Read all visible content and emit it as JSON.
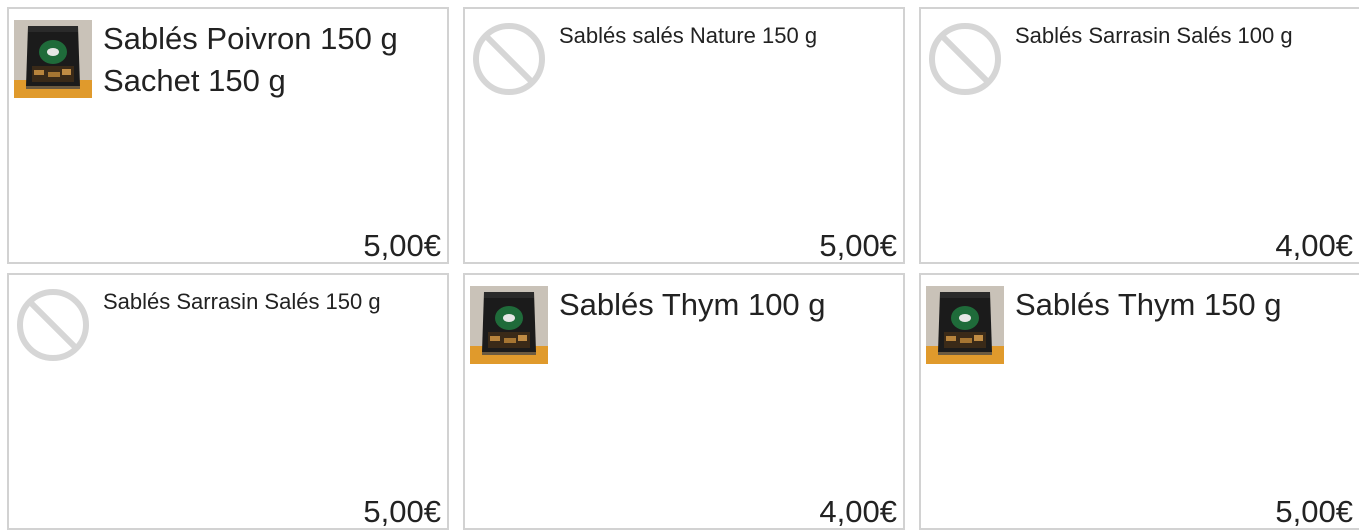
{
  "products": [
    {
      "title_lines": [
        "Sablés Poivron 150 g",
        "Sachet 150 g"
      ],
      "price": "5,00€",
      "image": "product-bag-photo",
      "title_size": "large"
    },
    {
      "title_lines": [
        "Sablés salés Nature 150 g"
      ],
      "price": "5,00€",
      "image": "no-image-icon",
      "title_size": "small"
    },
    {
      "title_lines": [
        "Sablés Sarrasin Salés 100 g"
      ],
      "price": "4,00€",
      "image": "no-image-icon",
      "title_size": "small"
    },
    {
      "title_lines": [
        "Sablés Sarrasin Salés 150 g"
      ],
      "price": "5,00€",
      "image": "no-image-icon",
      "title_size": "small"
    },
    {
      "title_lines": [
        "Sablés Thym 100 g"
      ],
      "price": "4,00€",
      "image": "product-bag-photo",
      "title_size": "large"
    },
    {
      "title_lines": [
        "Sablés Thym 150 g"
      ],
      "price": "5,00€",
      "image": "product-bag-photo",
      "title_size": "large"
    }
  ],
  "colors": {
    "card_border": "#d2d2d2",
    "text": "#222222",
    "photo_bg": "#e09a2c",
    "bag": "#1b1b1b",
    "label_green": "#1f6b3a",
    "placeholder": "#d6d6d6"
  }
}
